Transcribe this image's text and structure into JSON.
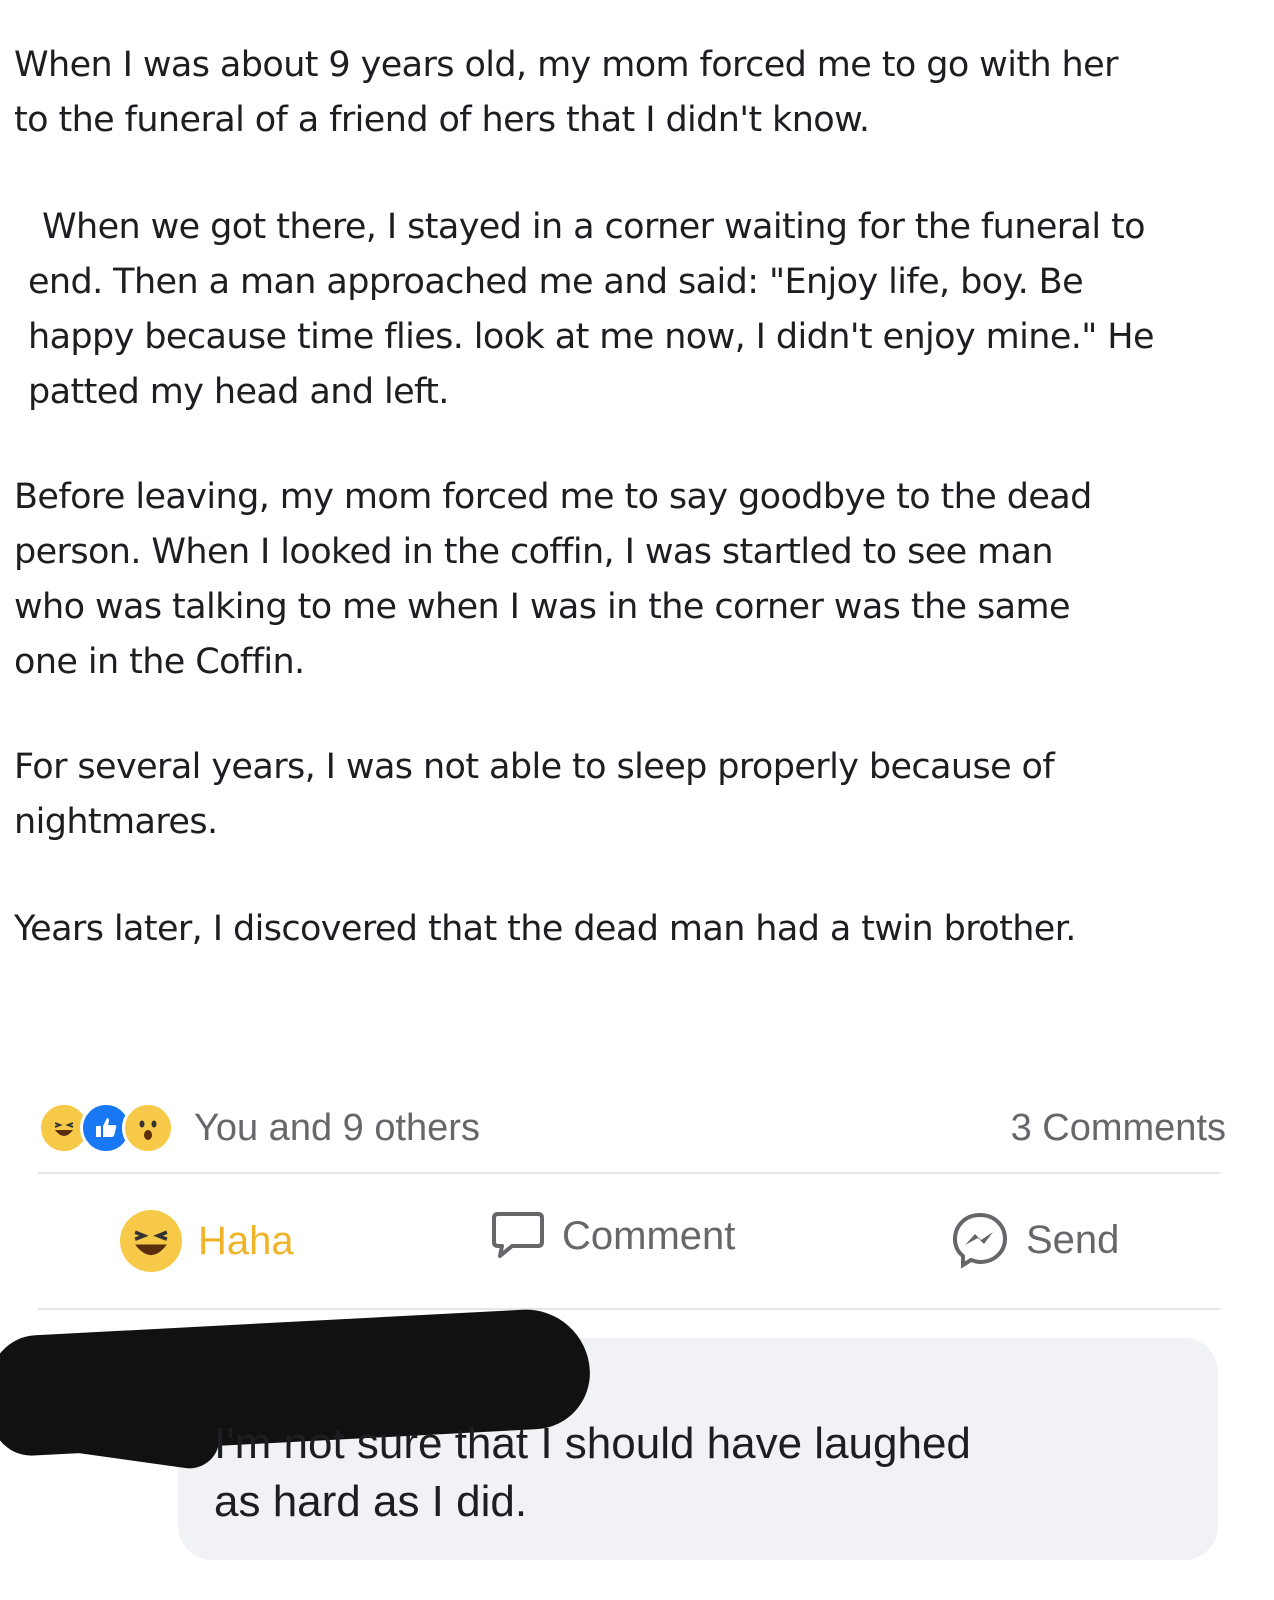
{
  "post": {
    "p1_l1": "When I was about 9 years old, my mom forced me to go with her",
    "p1_l2": "to the funeral of a friend of hers that I didn't know.",
    "p2_l1": "When we got there, I stayed in a corner waiting for the funeral to",
    "p2_l2": "end. Then a man approached me and said: \"Enjoy life, boy. Be",
    "p2_l3": "happy because time flies. look at me now, I didn't enjoy mine.\" He",
    "p2_l4": "patted my head and left.",
    "p3_l1": "Before leaving, my mom forced me to say goodbye to the dead",
    "p3_l2": "person. When I looked in the coffin, I was startled to see  man",
    "p3_l3": "who was talking to me when I was in the corner was the same",
    "p3_l4": "one in the Coffin.",
    "p4_l1": "For several years,  I was not able to sleep properly because of",
    "p4_l2": "nightmares.",
    "p5_l1": "Years later, I discovered that the dead man had a twin brother."
  },
  "reactions": {
    "icons": [
      "haha-icon",
      "like-icon",
      "wow-icon"
    ],
    "text": "You and 9 others",
    "comments_count": "3 Comments"
  },
  "actions": {
    "haha": "Haha",
    "comment": "Comment",
    "send": "Send"
  },
  "comment": {
    "line1": "I'm not sure that I should have laughed",
    "line2": "as hard as I did."
  },
  "colors": {
    "like_blue": "#1877f2",
    "haha_yellow": "#f7c948",
    "secondary_text": "#65676b",
    "bubble_bg": "#f0f2f5"
  }
}
